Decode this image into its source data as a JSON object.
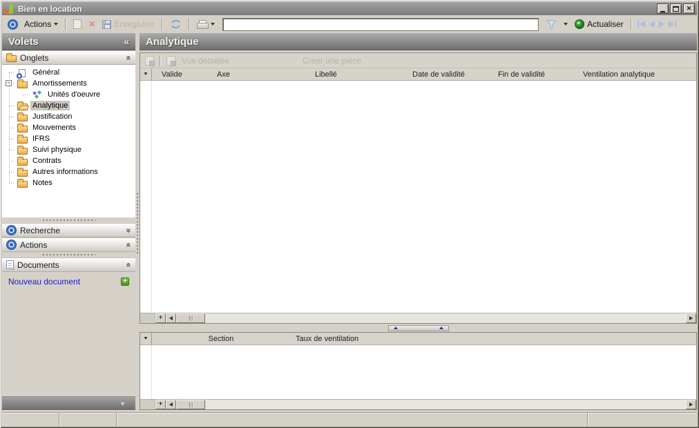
{
  "window": {
    "title": "Bien en location"
  },
  "glyphs": {
    "dropdown": "▼",
    "collapse_left": "«",
    "chevron_up_double": "«",
    "chevron_down_double": "»",
    "minus": "−",
    "plus": "+",
    "close": "✕",
    "star": "★",
    "footer_down": "▼",
    "delete_x": "✕"
  },
  "toolbar": {
    "actions_label": "Actions",
    "save_label": "Enregistrer",
    "refresh_label": "Actualiser",
    "search_value": ""
  },
  "sidebar": {
    "title": "Volets",
    "onglets_label": "Onglets",
    "recherche_label": "Recherche",
    "actions_label": "Actions",
    "documents_label": "Documents",
    "nouveau_document_label": "Nouveau document",
    "tree": [
      {
        "label": "Général",
        "icon": "page-gear"
      },
      {
        "label": "Amortissements",
        "icon": "folder-closed"
      },
      {
        "label": "Unités d'oeuvre",
        "icon": "diamonds"
      },
      {
        "label": "Analytique",
        "icon": "folder-open",
        "selected": true
      },
      {
        "label": "Justification",
        "icon": "folder-closed"
      },
      {
        "label": "Mouvements",
        "icon": "folder-closed"
      },
      {
        "label": "IFRS",
        "icon": "folder-closed"
      },
      {
        "label": "Suivi physique",
        "icon": "folder-closed"
      },
      {
        "label": "Contrats",
        "icon": "folder-closed"
      },
      {
        "label": "Autres informations",
        "icon": "folder-closed"
      },
      {
        "label": "Notes",
        "icon": "folder-closed"
      }
    ]
  },
  "main": {
    "title": "Analytique",
    "toolbar": {
      "vue_detaillee_label": "Vue détaillée",
      "creer_piece_label": "Créer une pièce"
    },
    "grid": {
      "columns": [
        "Valide",
        "Axe",
        "Libellé",
        "Date de validité",
        "Fin de validité",
        "Ventilation analytique"
      ],
      "rows": []
    },
    "bottom_grid": {
      "columns": [
        "Section",
        "Taux de ventilation"
      ],
      "rows": []
    }
  },
  "status_bar": {
    "cells": [
      "",
      "",
      "",
      ""
    ]
  },
  "colors": {
    "window_chrome": "#d5d1c9",
    "header_gradient_top": "#ababab",
    "header_gradient_bottom": "#6e6e6e",
    "accent_blue": "#2a62b8",
    "folder_yellow": "#f2bd5a",
    "link_blue": "#1a1ac8",
    "plus_green": "#4a9018",
    "disabled_text": "#9b988e"
  }
}
